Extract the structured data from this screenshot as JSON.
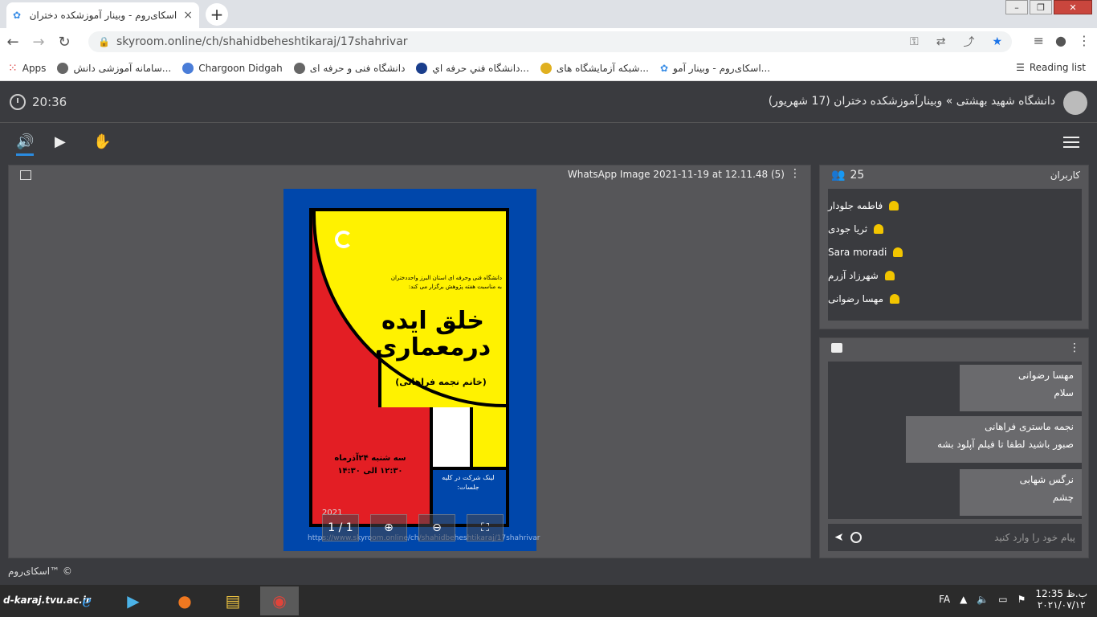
{
  "browser": {
    "tab_title": "اسکای‌روم - وبینار آموزشکده دختران",
    "tab_close": "×",
    "new_tab": "+",
    "url": "skyroom.online/ch/shahidbeheshtikaraj/17shahrivar",
    "window_buttons": {
      "minimize": "–",
      "maximize": "❐",
      "close": "✕"
    },
    "bookmarks": [
      {
        "label": "Apps"
      },
      {
        "label": "سامانه آموزشی دانش..."
      },
      {
        "label": "Chargoon Didgah"
      },
      {
        "label": "دانشگاه فنی و حرفه ای"
      },
      {
        "label": "دانشگاه فني حرفه اي..."
      },
      {
        "label": "شبکه آزمایشگاه های..."
      },
      {
        "label": "اسکای‌روم - وبینار آمو..."
      }
    ],
    "reading_list": "Reading list"
  },
  "header": {
    "time": "20:36",
    "breadcrumb": "دانشگاه شهید بهشتی » وبینارآموزشکده دختران (17 شهریور)"
  },
  "toolbar": {
    "volume_icon": "🔊",
    "share_icon": "▶",
    "hand_icon": "✋"
  },
  "stage": {
    "title": "WhatsApp Image 2021-11-19 at 12.11.48 (5)",
    "kebab": "⋮",
    "poster": {
      "intro": "دانشگاه فنی وحرفه ای استان البرز واحددختران به مناسبت هفته پژوهش برگزار می کند:",
      "title": "خلق ایده درمعماری",
      "subtitle": "(خانم نجمه فراهانی)",
      "date": "سه شنبه ۲۴آذرماه ۱۲:۳۰ الی ۱۴:۳۰",
      "note": "لینک شرکت در کلیه جلسات:",
      "year": "2021",
      "url": "https://www.skyroom.online/ch/shahidbeheshtikaraj/17shahrivar"
    },
    "page_indicator": "1 / 1",
    "zoom_in": "⊕",
    "zoom_out": "⊖",
    "fullscreen": "⛶"
  },
  "users": {
    "title": "کاربران",
    "count": "25",
    "list": [
      {
        "name": "فاطمه جلودار"
      },
      {
        "name": "ثریا جودی"
      },
      {
        "name": "Sara moradi"
      },
      {
        "name": "شهرزاد آزرم"
      },
      {
        "name": "مهسا رضوانی"
      }
    ]
  },
  "chat": {
    "kebab": "⋮",
    "messages": [
      {
        "author": "مهسا رضوانی",
        "text": "سلام"
      },
      {
        "author": "نجمه ماستری فراهانی",
        "text": "صبور باشید لطفا تا فیلم آپلود بشه"
      },
      {
        "author": "نرگس شهابی",
        "text": "چشم"
      }
    ],
    "placeholder": "پیام خود را وارد کنید",
    "send": "➤"
  },
  "footer": {
    "copyright": "اسکای‌روم™ ©"
  },
  "taskbar": {
    "logo": "d-karaj.tvu.ac.ir",
    "lang": "FA",
    "time": "ب.ظ 12:35",
    "date": "۲۰۲۱/۰۷/۱۲"
  }
}
